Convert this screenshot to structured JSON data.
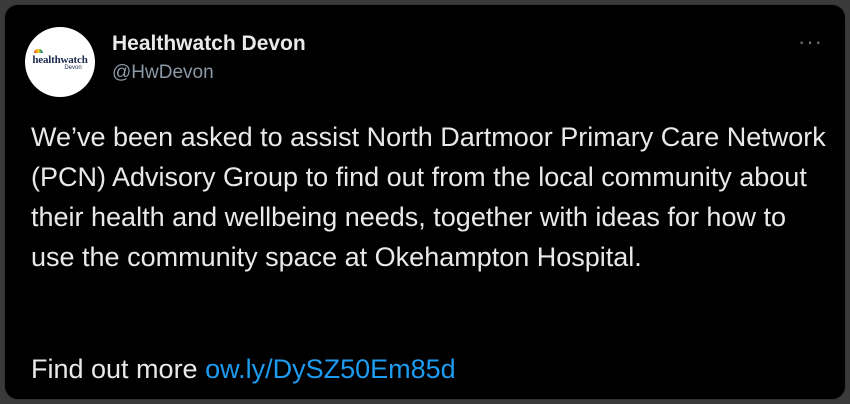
{
  "account": {
    "name": "Healthwatch Devon",
    "handle": "@HwDevon",
    "avatar_logo": "healthwatch",
    "avatar_sub": "Devon"
  },
  "menu_icon": "more-horizontal-icon",
  "tweet": {
    "text": "We’ve been asked to assist North Dartmoor Primary Care Network (PCN) Advisory Group to find out from the local community about their health and wellbeing needs, together with ideas for how to use the community space at Okehampton Hospital.",
    "cta_prefix": "Find out more",
    "link": "ow.ly/DySZ50Em85d"
  },
  "colors": {
    "background": "#000000",
    "text": "#e7e9ea",
    "secondary": "#8b98a5",
    "link": "#1d9bf0"
  }
}
